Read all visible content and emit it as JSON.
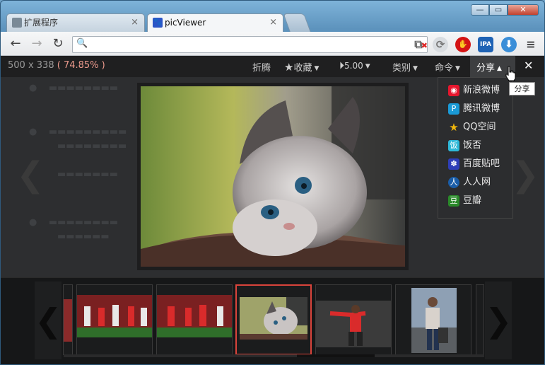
{
  "window": {
    "buttons": {
      "minimize": "—",
      "maximize": "▭",
      "close": "✕"
    }
  },
  "tabs": [
    {
      "label": "扩展程序",
      "close": "×"
    },
    {
      "label": "picViewer",
      "close": "×"
    }
  ],
  "toolbar": {
    "back": "←",
    "forward": "→",
    "reload": "↻",
    "omnibox_value": "",
    "extensions": {
      "ipa": "IPA"
    },
    "menu": "≡"
  },
  "viewer": {
    "dimensions": "500 x 338",
    "zoom_percent": "( 74.85% )",
    "bar": {
      "fold": "折腾",
      "favorite": "收藏",
      "play_speed": "5.00",
      "category": "类别",
      "command": "命令",
      "share": "分享",
      "close": "✕"
    },
    "tooltip": "分享",
    "share_menu": [
      {
        "label": "新浪微博",
        "icon": "weibo-icon",
        "color": "#e6162d"
      },
      {
        "label": "腾讯微博",
        "icon": "tencent-weibo-icon",
        "color": "#1a9ad6"
      },
      {
        "label": "QQ空间",
        "icon": "qzone-star-icon",
        "color": "#f1b70c"
      },
      {
        "label": "饭否",
        "icon": "fanfou-icon",
        "color": "#2eb8d8"
      },
      {
        "label": "百度贴吧",
        "icon": "baidu-paw-icon",
        "color": "#2e3eb8"
      },
      {
        "label": "人人网",
        "icon": "renren-icon",
        "color": "#1a5da8"
      },
      {
        "label": "豆瓣",
        "icon": "douban-icon",
        "color": "#2a8a2a"
      }
    ],
    "side_left": "❮",
    "side_right": "❯"
  },
  "thumbs": {
    "prev": "❮",
    "next": "❯"
  }
}
